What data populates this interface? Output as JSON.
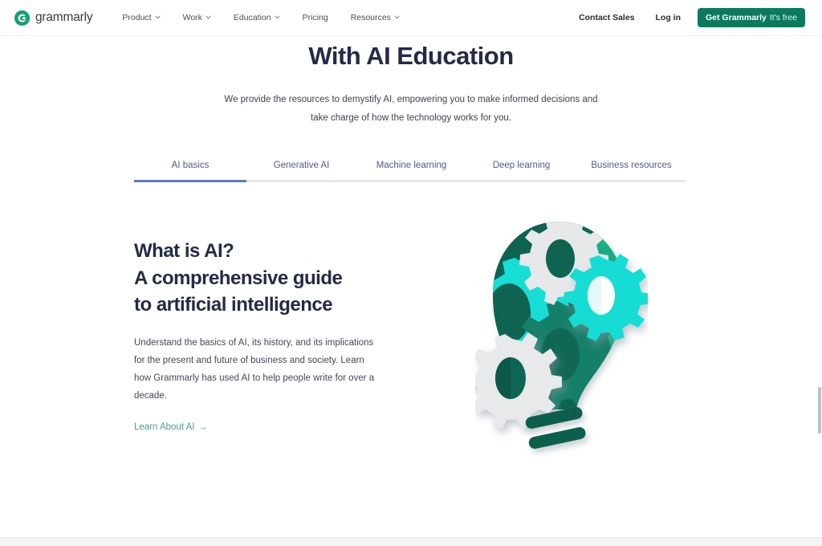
{
  "header": {
    "logo": {
      "icon": "grammarly-g-logo-icon",
      "wordmark": "grammarly",
      "brand_color": "#15a07a"
    },
    "nav_items": [
      {
        "label": "Product",
        "has_dropdown": true,
        "icon": "chevron-down-icon"
      },
      {
        "label": "Work",
        "has_dropdown": true,
        "icon": "chevron-down-icon"
      },
      {
        "label": "Education",
        "has_dropdown": true,
        "icon": "chevron-down-icon"
      },
      {
        "label": "Pricing",
        "has_dropdown": false,
        "icon": ""
      },
      {
        "label": "Resources",
        "has_dropdown": true,
        "icon": "chevron-down-icon"
      }
    ],
    "links": [
      {
        "label": "Contact Sales"
      },
      {
        "label": "Log in"
      }
    ],
    "cta": {
      "strong_label": "Get Grammarly",
      "light_label": "It's free",
      "background": "#0b7a5d",
      "text_color": "#ffffff"
    }
  },
  "hero": {
    "title": "With AI Education",
    "title_color": "#232b46",
    "subtitle": "We provide the resources to demystify AI, empowering you to make informed decisions and take charge of how the technology works for you."
  },
  "tabs": {
    "active_index": 0,
    "active_color": "#5c78c2",
    "text_color": "#4d5b96",
    "items": [
      {
        "label": "AI basics"
      },
      {
        "label": "Generative AI"
      },
      {
        "label": "Machine learning"
      },
      {
        "label": "Deep learning"
      },
      {
        "label": "Business resources"
      }
    ]
  },
  "content": {
    "heading_line_1": "What is AI?",
    "heading_line_2": "A comprehensive guide",
    "heading_line_3": "to artificial intelligence",
    "body": "Understand the basics of AI, its history, and its implications for the present and future of business and society. Learn how Grammarly has used AI to help people write for over a decade.",
    "link_label": "Learn About AI",
    "link_arrow": "→",
    "link_color": "#4a9d93"
  },
  "illustration": {
    "name": "lightbulb-with-gears-papercut-illustration",
    "palette": {
      "dark_teal": "#0d5f4e",
      "mid_teal": "#137e68",
      "teal": "#18a98a",
      "bright_cyan": "#18ddd4",
      "green_accent": "#1fbf7c",
      "light_gray": "#e4e6e8",
      "white_gray": "#eff1f2"
    }
  },
  "scrollbar": {
    "name": "vertical-scrollbar",
    "thumb_color": "#b6c2d1"
  }
}
